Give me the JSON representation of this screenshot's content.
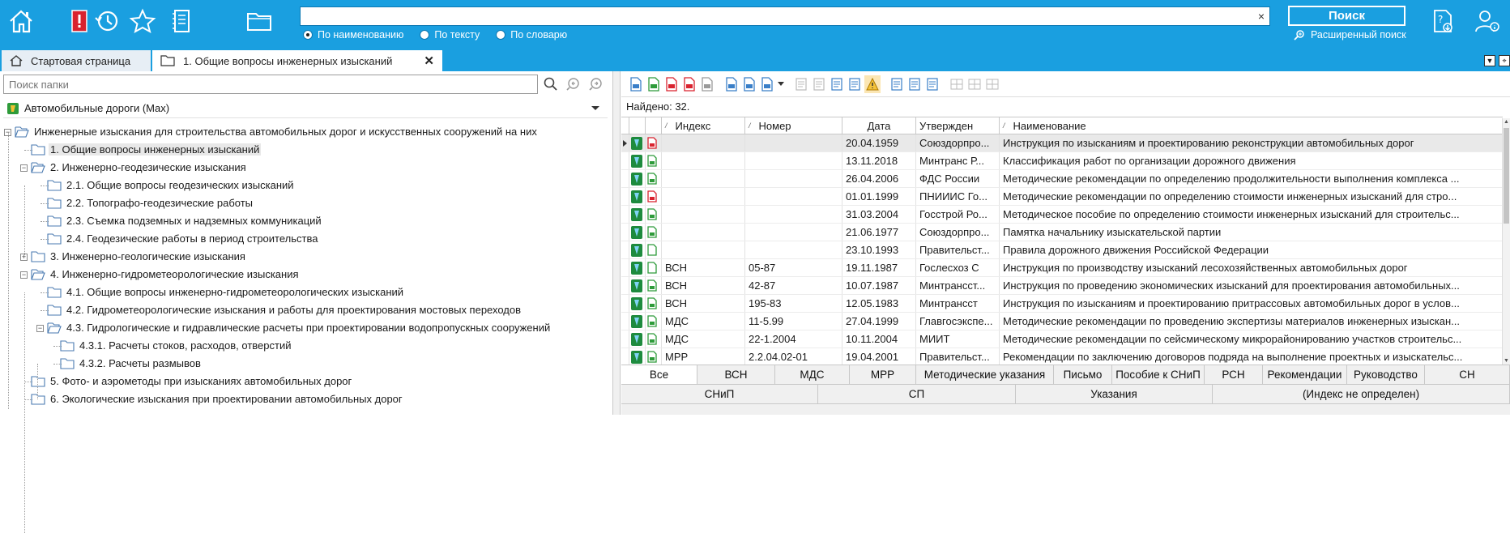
{
  "toolbar_top": {
    "icons": [
      "home-icon",
      "bookmark-icon",
      "history-icon",
      "favorites-icon",
      "notes-icon",
      "folder-icon"
    ],
    "search": {
      "value": "",
      "clear_glyph": "×"
    },
    "radios": [
      {
        "label": "По наименованию",
        "checked": true
      },
      {
        "label": "По тексту",
        "checked": false
      },
      {
        "label": "По словарю",
        "checked": false
      }
    ],
    "search_button": "Поиск",
    "advanced_search": "Расширенный поиск"
  },
  "tabs": {
    "start": "Стартовая страница",
    "active": "1. Общие вопросы инженерных изысканий",
    "close_glyph": "✕"
  },
  "left": {
    "folder_search_placeholder": "Поиск папки",
    "database": "Автомобильные дороги (Max)",
    "tree": [
      {
        "label": "Инженерные изыскания для строительства автомобильных дорог и искусственных сооружений на них",
        "level": 0,
        "exp": "-",
        "open": true
      },
      {
        "label": "1. Общие вопросы инженерных изысканий",
        "level": 1,
        "exp": "",
        "selected": true
      },
      {
        "label": "2. Инженерно-геодезические изыскания",
        "level": 1,
        "exp": "-",
        "open": true
      },
      {
        "label": "2.1. Общие вопросы геодезических изысканий",
        "level": 2,
        "exp": ""
      },
      {
        "label": "2.2. Топографо-геодезические работы",
        "level": 2,
        "exp": ""
      },
      {
        "label": "2.3. Съемка подземных и надземных коммуникаций",
        "level": 2,
        "exp": ""
      },
      {
        "label": "2.4. Геодезические работы в период строительства",
        "level": 2,
        "exp": ""
      },
      {
        "label": "3. Инженерно-геологические изыскания",
        "level": 1,
        "exp": "+"
      },
      {
        "label": "4. Инженерно-гидрометеорологические изыскания",
        "level": 1,
        "exp": "-",
        "open": true
      },
      {
        "label": "4.1. Общие вопросы инженерно-гидрометеорологических изысканий",
        "level": 2,
        "exp": ""
      },
      {
        "label": "4.2. Гидрометеорологические изыскания и работы для проектирования мостовых переходов",
        "level": 2,
        "exp": ""
      },
      {
        "label": "4.3. Гидрологические и гидравлические расчеты при проектировании водопропускных сооружений",
        "level": 2,
        "exp": "-",
        "open": true
      },
      {
        "label": "4.3.1. Расчеты стоков, расходов, отверстий",
        "level": 3,
        "exp": ""
      },
      {
        "label": "4.3.2. Расчеты размывов",
        "level": 3,
        "exp": ""
      },
      {
        "label": "5. Фото- и аэрометоды при изысканиях автомобильных дорог",
        "level": 1,
        "exp": ""
      },
      {
        "label": "6. Экологические изыскания при проектировании автомобильных дорог",
        "level": 1,
        "exp": ""
      }
    ]
  },
  "right": {
    "found": "Найдено: 32.",
    "columns": [
      "Индекс",
      "Номер",
      "Дата",
      "Утвержден",
      "Наименование"
    ],
    "rows": [
      {
        "status": "green",
        "doc": "red",
        "index": "",
        "number": "",
        "date": "20.04.1959",
        "approved": "Союздорпро...",
        "name": "Инструкция по изысканиям и проектированию реконструкции автомобильных дорог",
        "selected": true
      },
      {
        "status": "green",
        "doc": "green",
        "index": "",
        "number": "",
        "date": "13.11.2018",
        "approved": "Минтранс Р...",
        "name": "Классификация работ по организации дорожного движения"
      },
      {
        "status": "green",
        "doc": "green",
        "index": "",
        "number": "",
        "date": "26.04.2006",
        "approved": "ФДС России",
        "name": "Методические рекомендации по определению продолжительности выполнения комплекса ..."
      },
      {
        "status": "green",
        "doc": "red",
        "index": "",
        "number": "",
        "date": "01.01.1999",
        "approved": "ПНИИИС Го...",
        "name": "Методические рекомендации по определению стоимости инженерных изысканий для стро..."
      },
      {
        "status": "green",
        "doc": "green",
        "index": "",
        "number": "",
        "date": "31.03.2004",
        "approved": "Госстрой Ро...",
        "name": "Методическое пособие по определению стоимости инженерных изысканий для строительс..."
      },
      {
        "status": "green",
        "doc": "green",
        "index": "",
        "number": "",
        "date": "21.06.1977",
        "approved": "Союздорпро...",
        "name": "Памятка начальнику изыскательской партии"
      },
      {
        "status": "green",
        "doc": "outline",
        "index": "",
        "number": "",
        "date": "23.10.1993",
        "approved": "Правительст...",
        "name": "Правила дорожного движения Российской Федерации"
      },
      {
        "status": "green",
        "doc": "outline",
        "index": "ВСН",
        "number": "05-87",
        "date": "19.11.1987",
        "approved": "Гослесхоз С",
        "name": "Инструкция по производству изысканий лесохозяйственных автомобильных дорог"
      },
      {
        "status": "green",
        "doc": "green",
        "index": "ВСН",
        "number": "42-87",
        "date": "10.07.1987",
        "approved": "Минтрансст...",
        "name": "Инструкция по проведению экономических изысканий для проектирования автомобильных..."
      },
      {
        "status": "green",
        "doc": "green",
        "index": "ВСН",
        "number": "195-83",
        "date": "12.05.1983",
        "approved": "Минтрансст",
        "name": "Инструкция по изысканиям и проектированию притрассовых автомобильных дорог в услов..."
      },
      {
        "status": "green",
        "doc": "green",
        "index": "МДС",
        "number": "11-5.99",
        "date": "27.04.1999",
        "approved": "Главгосэкспе...",
        "name": "Методические рекомендации по проведению экспертизы материалов инженерных изыскан..."
      },
      {
        "status": "green",
        "doc": "green",
        "index": "МДС",
        "number": "22-1.2004",
        "date": "10.11.2004",
        "approved": "МИИТ",
        "name": "Методические рекомендации по сейсмическому микрорайонированию участков строительс..."
      },
      {
        "status": "green",
        "doc": "green",
        "index": "МРР",
        "number": "2.2.04.02-01",
        "date": "19.04.2001",
        "approved": "Правительст...",
        "name": "Рекомендации по заключению договоров подряда на выполнение проектных и изыскательс..."
      }
    ],
    "filters_row1": [
      {
        "label": "Все",
        "active": true
      },
      {
        "label": "ВСН"
      },
      {
        "label": "МДС"
      },
      {
        "label": "МРР"
      },
      {
        "label": "Методические указания"
      },
      {
        "label": "Письмо"
      },
      {
        "label": "Пособие к СНиП"
      },
      {
        "label": "РСН"
      },
      {
        "label": "Рекомендации"
      },
      {
        "label": "Руководство"
      },
      {
        "label": "СН"
      }
    ],
    "filters_row2": [
      {
        "label": "СНиП"
      },
      {
        "label": "СП"
      },
      {
        "label": "Указания"
      },
      {
        "label": "(Индекс не определен)"
      }
    ]
  },
  "colors": {
    "topbar": "#1a9fe0",
    "doc_green": "#2e9b3a",
    "doc_red": "#d9232f",
    "status_green": "#1e8b3e"
  }
}
